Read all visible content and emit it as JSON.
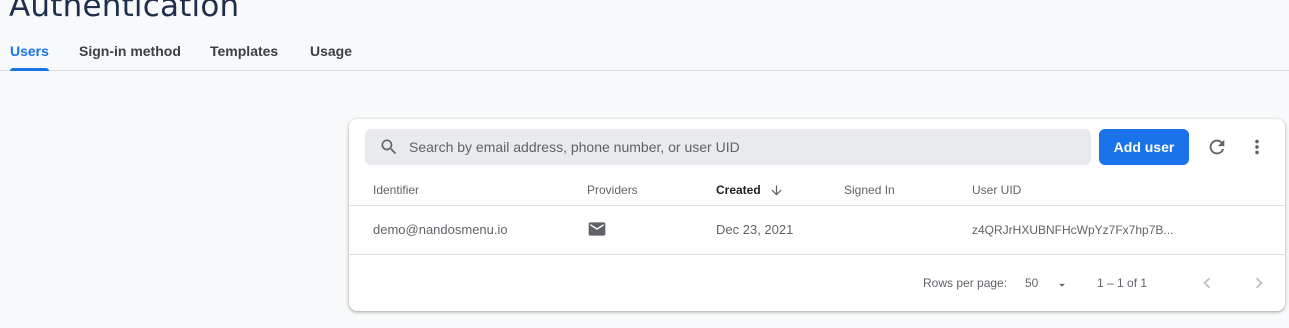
{
  "page": {
    "title": "Authentication"
  },
  "tabs": [
    {
      "label": "Users",
      "active": true
    },
    {
      "label": "Sign-in method",
      "active": false
    },
    {
      "label": "Templates",
      "active": false
    },
    {
      "label": "Usage",
      "active": false
    }
  ],
  "toolbar": {
    "search_placeholder": "Search by email address, phone number, or user UID",
    "search_value": "",
    "add_user_label": "Add user",
    "refresh_icon": "refresh-icon",
    "more_icon": "more-vert-icon"
  },
  "table": {
    "columns": [
      "Identifier",
      "Providers",
      "Created",
      "Signed In",
      "User UID"
    ],
    "sorted_column": "Created",
    "sort_direction": "descending",
    "rows": [
      {
        "identifier": "demo@nandosmenu.io",
        "provider_icon": "email-icon",
        "created": "Dec 23, 2021",
        "signed_in": "",
        "uid": "z4QRJrHXUBNFHcWpYz7Fx7hp7B..."
      }
    ]
  },
  "pagination": {
    "rows_per_page_label": "Rows per page:",
    "rows_per_page_value": "50",
    "range_text": "1 – 1 of 1"
  },
  "colors": {
    "accent": "#1a73e8",
    "title": "#1f2e4d",
    "background": "#f8f9fa"
  }
}
